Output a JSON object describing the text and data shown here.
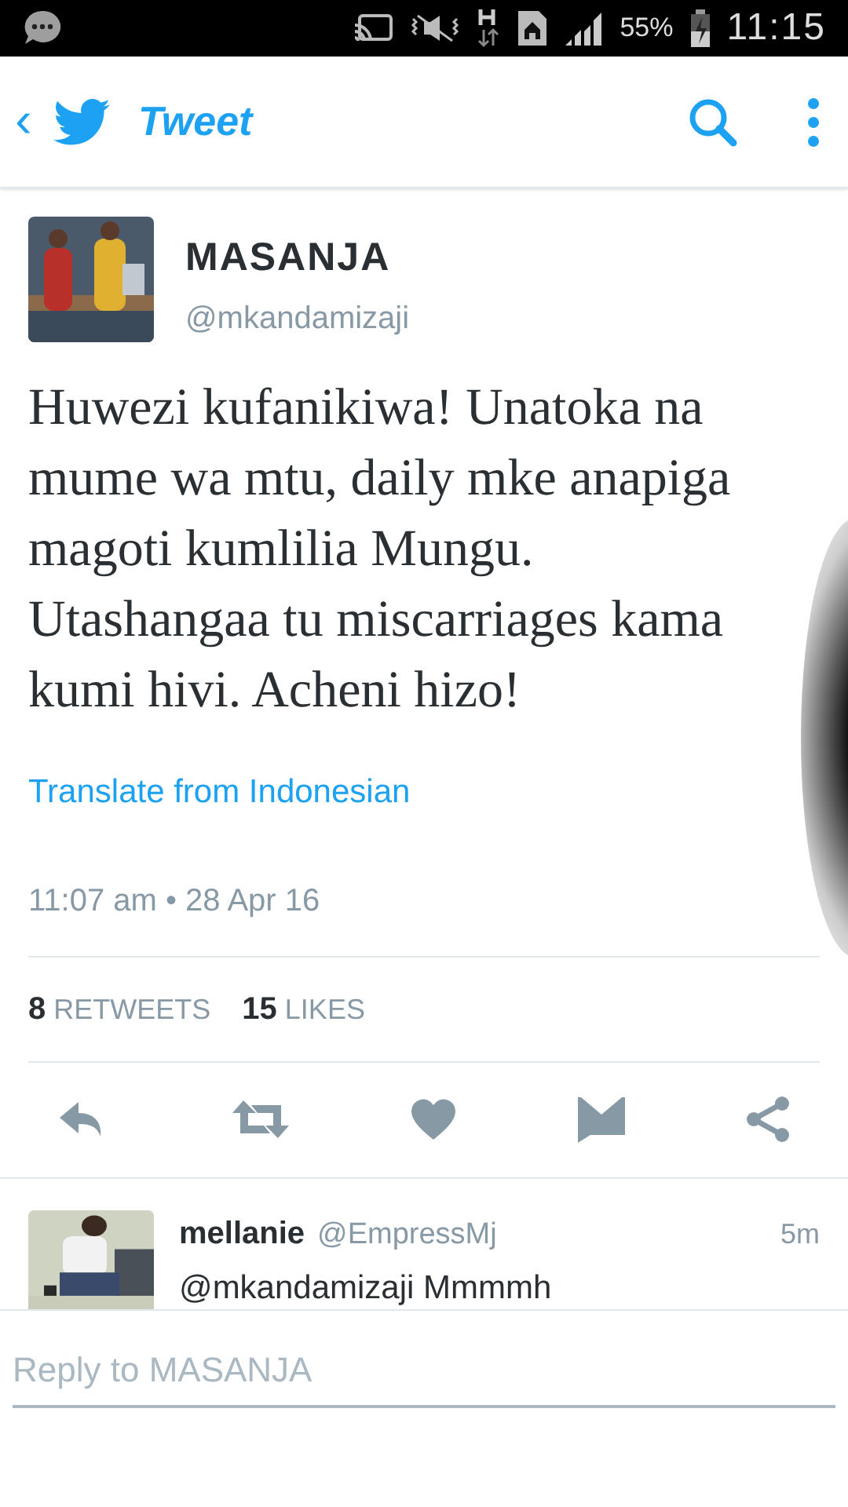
{
  "status_bar": {
    "battery": "55%",
    "time": "11:15"
  },
  "app_bar": {
    "back": "‹",
    "title": "Tweet"
  },
  "tweet": {
    "name": "MASANJA",
    "handle": "@mkandamizaji",
    "text": "Huwezi kufanikiwa! Unatoka na mume wa mtu, daily mke anapiga magoti kumlilia Mungu. Utashangaa tu miscarriages kama kumi hivi. Acheni hizo!",
    "translate": "Translate from Indonesian",
    "timestamp": "11:07 am • 28 Apr 16",
    "retweets": {
      "count": "8",
      "label": "RETWEETS"
    },
    "likes": {
      "count": "15",
      "label": "LIKES"
    },
    "liked": false
  },
  "replies": [
    {
      "name": "mellanie",
      "handle": "@EmpressMj",
      "time": "5m",
      "text": "@mkandamizaji Mmmmh"
    }
  ],
  "reply_box": {
    "placeholder": "Reply to MASANJA"
  }
}
